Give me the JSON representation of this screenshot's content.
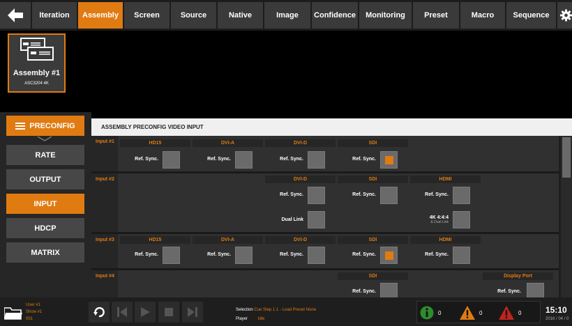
{
  "nav": {
    "tabs": [
      {
        "label": "Iteration",
        "active": false
      },
      {
        "label": "Assembly",
        "active": true
      },
      {
        "label": "Screen",
        "active": false
      },
      {
        "label": "Source",
        "active": false
      },
      {
        "label": "Native",
        "active": false
      },
      {
        "label": "Image",
        "active": false
      },
      {
        "label": "Confidence",
        "active": false
      },
      {
        "label": "Monitoring",
        "active": false
      },
      {
        "label": "Preset",
        "active": false
      },
      {
        "label": "Macro",
        "active": false
      },
      {
        "label": "Sequence",
        "active": false
      }
    ],
    "back_icon": "arrow-left-icon",
    "settings_icon": "gear-icon"
  },
  "assembly": {
    "name": "Assembly #1",
    "model": "ASC3204 4K",
    "icon": "device-stack-icon"
  },
  "sidebar": {
    "preconfig_label": "PRECONFIG",
    "items": [
      {
        "label": "RATE",
        "active": false
      },
      {
        "label": "OUTPUT",
        "active": false
      },
      {
        "label": "INPUT",
        "active": true
      },
      {
        "label": "HDCP",
        "active": false
      },
      {
        "label": "MATRIX",
        "active": false
      }
    ]
  },
  "main": {
    "header": "ASSEMBLY PRECONFIG VIDEO INPUT",
    "ref_sync": "Ref. Sync.",
    "dual_link": "Dual Link",
    "fourk": "4K 4:4:4",
    "dual_link_small": "& Dual Link",
    "inputs": [
      {
        "label": "Input #1",
        "cols": {
          "hd15": "HD15",
          "dvia": "DVI-A",
          "dvid": "DVI-D",
          "sdi": "SDI"
        }
      },
      {
        "label": "Input #2",
        "cols": {
          "dvid": "DVI-D",
          "sdi": "SDI",
          "hdmi": "HDMI"
        }
      },
      {
        "label": "Input #3",
        "cols": {
          "hd15": "HD15",
          "dvia": "DVI-A",
          "dvid": "DVI-D",
          "sdi": "SDI",
          "hdmi": "HDMI"
        }
      },
      {
        "label": "Input #4",
        "cols": {
          "sdi": "SDI",
          "dp": "Display Port"
        }
      }
    ],
    "checked": {
      "input1_sdi": true,
      "input3_sdi": true
    }
  },
  "footer": {
    "user": "User #1",
    "show": "Show #1",
    "code": "001",
    "selection_label": "Selection",
    "selection_value": "Cue Step 1.1 - Load Preset None",
    "player_label": "Player",
    "player_value": "Idle",
    "info_count": "0",
    "warning_count": "0",
    "error_count": "0",
    "time": "15:10",
    "date": "2016 / 04 / 0"
  },
  "colors": {
    "accent": "#e07b12",
    "info": "#2e8b2e",
    "warning": "#e07b12",
    "error": "#c0241c"
  }
}
